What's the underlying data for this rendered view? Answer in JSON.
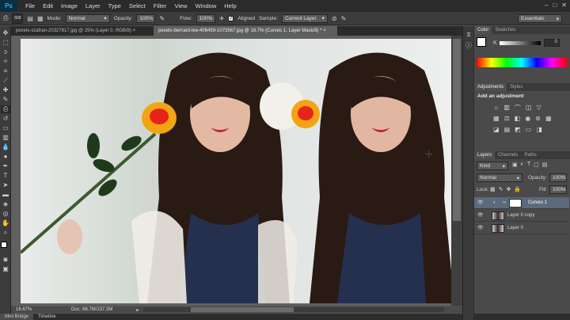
{
  "menubar": {
    "logo": "Ps",
    "items": [
      "File",
      "Edit",
      "Image",
      "Layer",
      "Type",
      "Select",
      "Filter",
      "View",
      "Window",
      "Help"
    ],
    "window_controls": [
      "–",
      "□",
      "✕"
    ]
  },
  "options": {
    "brush_size": "500",
    "mode_label": "Mode:",
    "mode_value": "Normal",
    "opacity_label": "Opacity:",
    "opacity_value": "100%",
    "flow_label": "Flow:",
    "flow_value": "100%",
    "aligned_label": "Aligned",
    "sample_label": "Sample:",
    "sample_value": "Current Layer",
    "workspace": "Essentials"
  },
  "tabs": [
    {
      "label": "pexels-szafran-20327617.jpg @ 25% (Layer 0, RGB/8) ×",
      "active": false
    },
    {
      "label": "pexels-bernard-lee-406459-1073567.jpg @ 16.7% (Curves 1, Layer Mask/8) * ×",
      "active": true
    }
  ],
  "status": {
    "zoom": "16.67%",
    "doc": "Doc: 68.7M/137.3M"
  },
  "bottom_tabs": [
    "Mini Bridge",
    "Timeline"
  ],
  "color_panel": {
    "tabs": [
      "Color",
      "Swatches"
    ],
    "k_label": "K",
    "k_value": "0"
  },
  "adjustments_panel": {
    "tabs": [
      "Adjustments",
      "Styles"
    ],
    "title": "Add an adjustment"
  },
  "layers_panel": {
    "tabs": [
      "Layers",
      "Channels",
      "Paths"
    ],
    "kind": "Kind",
    "blend": "Normal",
    "opacity_label": "Opacity:",
    "opacity_value": "100%",
    "lock_label": "Lock:",
    "fill_label": "Fill:",
    "fill_value": "100%",
    "layers": [
      {
        "name": "Curves 1",
        "selected": true
      },
      {
        "name": "Layer 0 copy",
        "selected": false
      },
      {
        "name": "Layer 0",
        "selected": false
      }
    ]
  },
  "colors": {
    "accent": "#31a8ff",
    "selected_layer": "#5b6a7d"
  }
}
